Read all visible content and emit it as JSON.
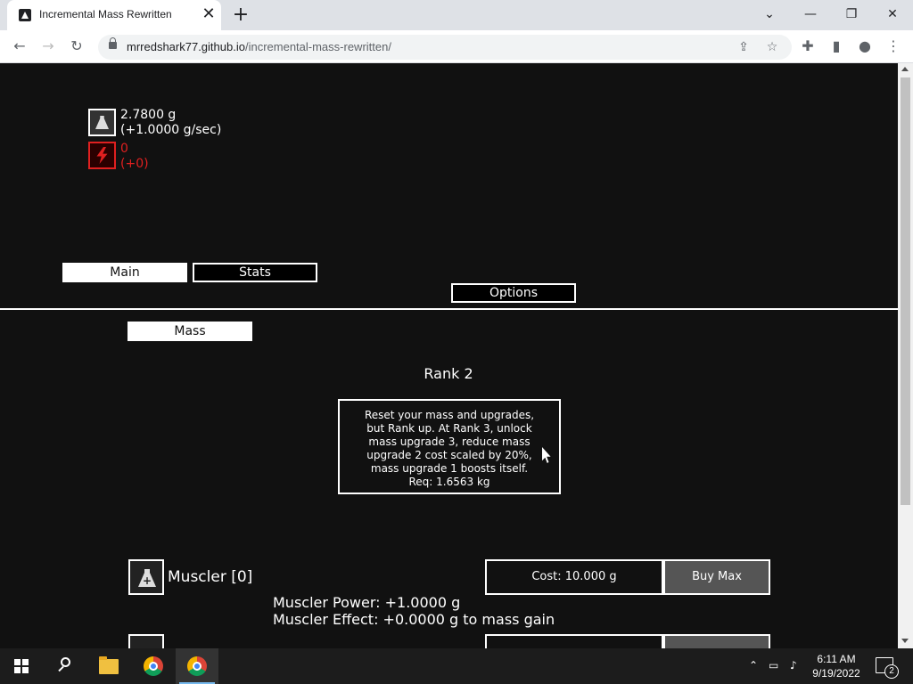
{
  "browser": {
    "tab_title": "Incremental Mass Rewritten",
    "tab_close": "✕",
    "new_tab": "+",
    "url_host": "mrredshark77.github.io",
    "url_path": "/incremental-mass-rewritten/",
    "win_minimize": "—",
    "win_restore": "❐",
    "win_close": "✕",
    "tab_search": "⌄",
    "back": "←",
    "forward": "→",
    "reload": "↻",
    "share": "⇪",
    "bookmark": "☆",
    "extensions": "✚",
    "sidepanel": "▮",
    "profile": "●",
    "menu": "⋮"
  },
  "resources": {
    "mass_amount": "2.7800 g",
    "mass_rate": "(+1.0000 g/sec)",
    "rage_amount": "0",
    "rage_rate": "(+0)"
  },
  "tabs": {
    "main": "Main",
    "stats": "Stats",
    "options": "Options",
    "mass": "Mass"
  },
  "rank": {
    "title": "Rank 2",
    "description_lines": [
      "Reset your mass and upgrades,",
      "but Rank up. At Rank 3, unlock",
      "mass upgrade 3, reduce mass",
      "upgrade 2 cost scaled by 20%,",
      "mass upgrade 1 boosts itself.",
      "Req: 1.6563 kg"
    ]
  },
  "upgrades": [
    {
      "name": "Muscler [0]",
      "cost": "Cost: 10.000 g",
      "buy_max": "Buy Max",
      "power": "Muscler Power: +1.0000 g",
      "effect": "Muscler Effect: +0.0000 g to mass gain"
    }
  ],
  "taskbar": {
    "time": "6:11 AM",
    "date": "9/19/2022",
    "notifications": "2",
    "tray_chevron": "⌃",
    "tray_network": "▭",
    "tray_volume": "♪"
  }
}
